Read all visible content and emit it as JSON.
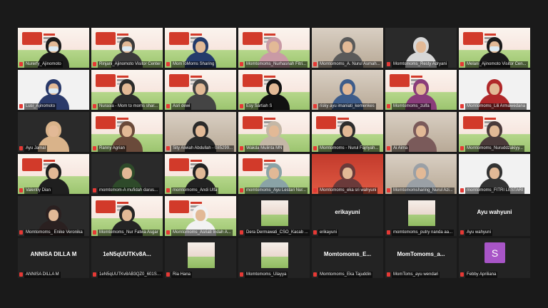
{
  "meeting": {
    "participants": [
      {
        "name": "Nurerfy_Ajinomoto",
        "style": "banner",
        "hijab": "#1b1b1b",
        "mask": true
      },
      {
        "name": "Rinjani_Ajinomoto Visitor Center",
        "style": "banner",
        "hijab": "#3a3a3a",
        "mask": true,
        "active": true
      },
      {
        "name": "MomToMoms Sharing",
        "style": "banner",
        "hijab": "#243b6b",
        "mask": false
      },
      {
        "name": "Momtomoms_Nurhasnah Fitri...",
        "style": "banner",
        "hijab": "#c99aa5",
        "mask": false
      },
      {
        "name": "Momtomoms_A. Nurul Asmah...",
        "style": "room",
        "hijab": "#5a5a5a",
        "mask": false
      },
      {
        "name": "Momtomoms_Resty Adryani",
        "style": "dark",
        "hijab": "#d7d7d7",
        "mask": false
      },
      {
        "name": "Melani_Ajinomoto Visitor Cen...",
        "style": "banner",
        "hijab": "#1b1b1b",
        "mask": true
      },
      {
        "name": "Lusi_Ajinomoto",
        "style": "white",
        "hijab": "#2a3a6a",
        "mask": true
      },
      {
        "name": "Nurasia - Mom to moms shar...",
        "style": "banner",
        "hijab": "#2b2b2b",
        "mask": false
      },
      {
        "name": "Asri dewi",
        "style": "banner",
        "hijab": "#444444",
        "mask": false
      },
      {
        "name": "Esy Sartiah S",
        "style": "banner",
        "hijab": "#111111",
        "mask": false
      },
      {
        "name": "risky ayu imaniati_kemenkes",
        "style": "room",
        "hijab": "#3d5c8a",
        "mask": false
      },
      {
        "name": "Momtomoms_zulfa",
        "style": "banner",
        "hijab": "#8a3c7a",
        "mask": false
      },
      {
        "name": "Momtomoms_Lili Armawedana",
        "style": "white",
        "hijab": "#b0282a",
        "mask": false
      },
      {
        "name": "Ayu Jamal",
        "style": "dark",
        "hijab": "#d9b38a",
        "mask": false
      },
      {
        "name": "Ranny Agrian",
        "style": "banner",
        "hijab": "#6a4a3a",
        "mask": false
      },
      {
        "name": "Sity Alwiah Abdullah - 085299...",
        "style": "room",
        "hijab": "#2a2a2a",
        "mask": false
      },
      {
        "name": "Wakda Mulinta MN",
        "style": "banner",
        "hijab": "#c4b7a6",
        "mask": false
      },
      {
        "name": "Momtomoms - Nurul Fajriyah...",
        "style": "banner",
        "hijab": "#2d2d2d",
        "mask": false
      },
      {
        "name": "Ai Aima",
        "style": "room",
        "hijab": "#7a5a5a",
        "mask": false
      },
      {
        "name": "Momtomoms_Nuruddzakiyy...",
        "style": "banner",
        "hijab": "#4a3a3a",
        "mask": false
      },
      {
        "name": "Valentiy Dian",
        "style": "banner",
        "hijab": "#1f1f1f",
        "mask": false
      },
      {
        "name": "momtomom-A mufidah darus...",
        "style": "dark",
        "hijab": "#2e4a2a",
        "mask": false
      },
      {
        "name": "momtomoms_Andi Ulfa",
        "style": "banner",
        "hijab": "#222222",
        "mask": false
      },
      {
        "name": "momtomoms_Ayu Lestari Nur...",
        "style": "banner",
        "hijab": "#8aa3a6",
        "mask": false
      },
      {
        "name": "Momtomoms_eka sri wahyuni",
        "style": "red",
        "hijab": "#6a3a3a",
        "mask": false
      },
      {
        "name": "Momtomomsharing_Nurul Azi...",
        "style": "room",
        "hijab": "#9aa0a6",
        "mask": false
      },
      {
        "name": "momtomoms_FITRI LESTARI",
        "style": "white",
        "hijab": "#333333",
        "mask": false
      },
      {
        "name": "Momtomoms_ Enike Veronika",
        "style": "dark",
        "hijab": "#2a2020",
        "mask": false
      },
      {
        "name": "Momtomoms_Nur Fatwa Asgar",
        "style": "banner",
        "hijab": "#242424",
        "mask": false
      },
      {
        "name": "Momtomoms_Asriati Indah A...",
        "style": "banner",
        "hijab": "#f2f2f2",
        "mask": false
      },
      {
        "name": "Dera Dermawati_CSO_Kacab ...",
        "style": "thumb",
        "center": "",
        "mask": false
      },
      {
        "name": "erikayuni",
        "style": "text",
        "center": "erikayuni"
      },
      {
        "name": "momtomoms_putry nanda aa...",
        "style": "thumb",
        "center": "",
        "mask": false
      },
      {
        "name": "Ayu wahyuni",
        "style": "text",
        "center": "Ayu wahyuni"
      },
      {
        "name": "ANNISA DILLA M",
        "style": "text",
        "center": "ANNISA DILLA M"
      },
      {
        "name": "1eN5qUUTKv8AB3QZ0_601Sw...",
        "style": "text",
        "center": "1eN5qUUTKv8A..."
      },
      {
        "name": "Ria Hana",
        "style": "thumb",
        "center": ""
      },
      {
        "name": "Momtomoms_Ulayya",
        "style": "thumb",
        "center": ""
      },
      {
        "name": "Momtomoms_Eka Tajuddin",
        "style": "text",
        "center": "Momtomoms_E..."
      },
      {
        "name": "MomToms_ayu wendari",
        "style": "text",
        "center": "MomTomoms_a..."
      },
      {
        "name": "Febby Apriliana",
        "style": "avatar",
        "center": "S"
      }
    ]
  }
}
